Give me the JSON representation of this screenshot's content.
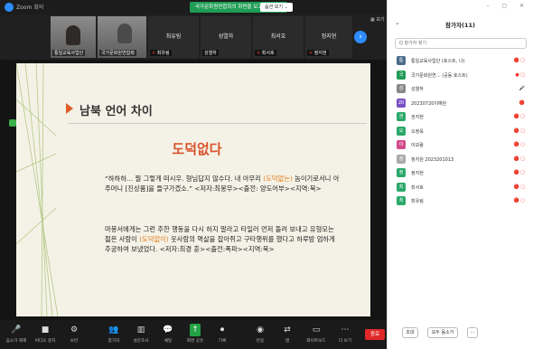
{
  "window": {
    "app_title": "Zoom 회의"
  },
  "share": {
    "banner": "국가문화원연합회의 화면을 보고 있습니다",
    "view_options": "옵션 보기 ⌄"
  },
  "strip": {
    "tiles": [
      {
        "name": "통일교육사업단",
        "kind": "video"
      },
      {
        "name": "국가문화원연합회",
        "kind": "video"
      },
      {
        "name": "최유림",
        "bigname": "최유림",
        "kind": "name"
      },
      {
        "name": "성열하",
        "bigname": "성열하",
        "kind": "name"
      },
      {
        "name": "최서호",
        "bigname": "최서호",
        "kind": "name"
      },
      {
        "name": "정지현",
        "bigname": "정지현",
        "kind": "name"
      }
    ],
    "corner_label": "▦ 보기"
  },
  "slide": {
    "heading": "남북 언어 차이",
    "word": "도덕없다",
    "para1_a": "“하하하… 뭘 그렇게 떠시우. 형님답지 않수다. 내 아무리 ",
    "para1_hl": "(도덕없는)",
    "para1_b": " 놈이기로서니 아주머니 [진상품]을 들구가겠소.” <저자:최봉무><출전: 양도어부><지역:북>",
    "para2_a": "마봉서에게는 그런 추한 행동을 다시 하지 말라고 타일러 먼저 돌려 보내고 유형모는 젊은 사람이 ",
    "para2_hl": "(도덕없이)",
    "para2_b": " 웃사람의 멱살을 잡아쥐고 구타행위를 했다고 하루밤 엄하게 추궁하여 보냈었다. <저자:최경 훈><출전:폭파><지역:북>"
  },
  "toolbar": {
    "items": [
      {
        "icon": "🎤",
        "label": "음소거 해제"
      },
      {
        "icon": "■",
        "label": "비디오 중지"
      },
      {
        "icon": "⚙",
        "label": "보안"
      },
      {
        "icon": "👥",
        "label": "참가자"
      },
      {
        "icon": "▥",
        "label": "설문조사"
      },
      {
        "icon": "💬",
        "label": "채팅"
      },
      {
        "icon": "↑",
        "label": "화면 공유"
      },
      {
        "icon": "⏺",
        "label": "기록"
      },
      {
        "icon": "◉",
        "label": "반응"
      },
      {
        "icon": "⇄",
        "label": "앱"
      },
      {
        "icon": "▭",
        "label": "화이트보드"
      },
      {
        "icon": "⋯",
        "label": "더 보기"
      }
    ],
    "end_label": "종료"
  },
  "panel": {
    "title": "참가자(11)",
    "search_placeholder": "Q 참가자 찾기",
    "participants": [
      {
        "initial": "통",
        "name": "통일교육사업단 (호스트, 나)",
        "color": "#4a6b8a",
        "icons": "🔴 ▢"
      },
      {
        "initial": "국",
        "name": "국가문화원연… (공동 호스트)",
        "color": "#1f9d55",
        "icons": "● ▢"
      },
      {
        "initial": "성",
        "name": "성열하",
        "color": "#888888",
        "icons": "🎤"
      },
      {
        "initial": "20",
        "name": "20230720이예린",
        "color": "#7b4fc4",
        "icons": "🔴"
      },
      {
        "initial": "권",
        "name": "권지현",
        "color": "#2aa86a",
        "icons": "🔴 ▢"
      },
      {
        "initial": "오",
        "name": "오정욱",
        "color": "#2aa86a",
        "icons": "🔴 ▢"
      },
      {
        "initial": "이",
        "name": "이보람",
        "color": "#d14a8a",
        "icons": "🔴 ▢"
      },
      {
        "initial": "정",
        "name": "정지원 2023201013",
        "color": "#aaaaaa",
        "icons": "🔴 ▢"
      },
      {
        "initial": "정",
        "name": "정지현",
        "color": "#2aa86a",
        "icons": "🔴 ▢"
      },
      {
        "initial": "최",
        "name": "최서호",
        "color": "#2aa86a",
        "icons": "🔴 ▢"
      },
      {
        "initial": "최",
        "name": "최유림",
        "color": "#2aa86a",
        "icons": "🔴 ▢"
      }
    ],
    "invite_label": "초대",
    "mute_all_label": "모두 음소거",
    "more_label": "⋯"
  }
}
